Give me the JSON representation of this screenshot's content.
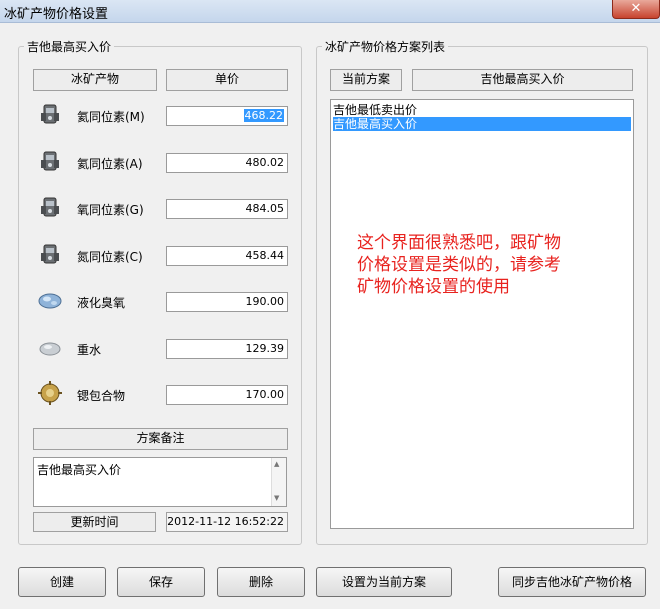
{
  "window": {
    "title": "冰矿产物价格设置",
    "close_glyph": "✕"
  },
  "left_group": {
    "title": "吉他最高买入价",
    "col_product": "冰矿产物",
    "col_price": "单价",
    "rows": [
      {
        "name": "氦同位素(M)",
        "price": "468.22",
        "icon": "isotope-canister-icon"
      },
      {
        "name": "氦同位素(A)",
        "price": "480.02",
        "icon": "isotope-canister-icon"
      },
      {
        "name": "氧同位素(G)",
        "price": "484.05",
        "icon": "isotope-canister-icon"
      },
      {
        "name": "氮同位素(C)",
        "price": "458.44",
        "icon": "isotope-canister-icon"
      },
      {
        "name": "液化臭氧",
        "price": "190.00",
        "icon": "liquid-ozone-icon"
      },
      {
        "name": "重水",
        "price": "129.39",
        "icon": "heavy-water-icon"
      },
      {
        "name": "锶包合物",
        "price": "170.00",
        "icon": "strontium-clathrate-icon"
      }
    ],
    "memo_header": "方案备注",
    "memo_text": "吉他最高买入价",
    "update_time_label": "更新时间",
    "update_time_value": "2012-11-12 16:52:22"
  },
  "right_group": {
    "title": "冰矿产物价格方案列表",
    "current_label": "当前方案",
    "current_value": "吉他最高买入价",
    "plans": [
      "吉他最低卖出价",
      "吉他最高买入价"
    ],
    "selected_index": 1
  },
  "annotation": {
    "lines": [
      "这个界面很熟悉吧，跟矿物",
      "价格设置是类似的，请参考",
      "矿物价格设置的使用"
    ],
    "color": "#e8231f"
  },
  "buttons": {
    "create": "创建",
    "save": "保存",
    "delete": "删除",
    "set_current": "设置为当前方案",
    "sync": "同步吉他冰矿产物价格"
  }
}
